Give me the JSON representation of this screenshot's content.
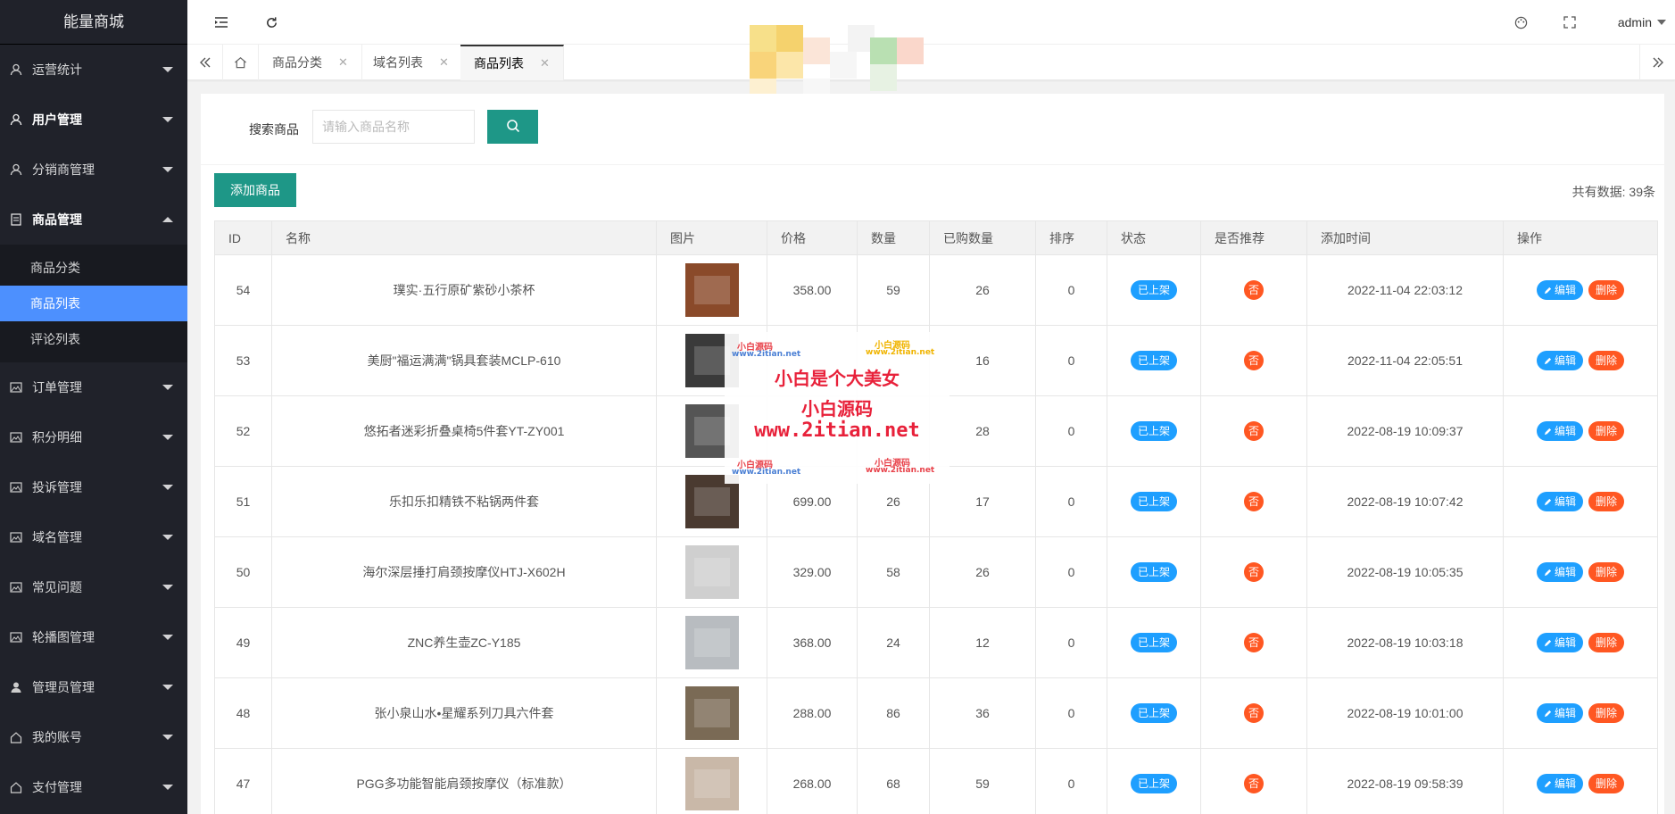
{
  "sidebar": {
    "logo": "能量商城",
    "items": [
      {
        "label": "运营统计"
      },
      {
        "label": "用户管理"
      },
      {
        "label": "分销商管理"
      },
      {
        "label": "商品管理"
      },
      {
        "label": "订单管理"
      },
      {
        "label": "积分明细"
      },
      {
        "label": "投诉管理"
      },
      {
        "label": "域名管理"
      },
      {
        "label": "常见问题"
      },
      {
        "label": "轮播图管理"
      },
      {
        "label": "管理员管理"
      },
      {
        "label": "我的账号"
      },
      {
        "label": "支付管理"
      }
    ],
    "sub_items": [
      {
        "label": "商品分类"
      },
      {
        "label": "商品列表"
      },
      {
        "label": "评论列表"
      }
    ]
  },
  "header": {
    "user": "admin"
  },
  "tabs": [
    {
      "label": "商品分类"
    },
    {
      "label": "域名列表"
    },
    {
      "label": "商品列表"
    }
  ],
  "search": {
    "label": "搜索商品",
    "placeholder": "请输入商品名称"
  },
  "toolbar": {
    "add_label": "添加商品",
    "total": "共有数据:  39条"
  },
  "table": {
    "columns": [
      "ID",
      "名称",
      "图片",
      "价格",
      "数量",
      "已购数量",
      "排序",
      "状态",
      "是否推荐",
      "添加时间",
      "操作"
    ],
    "status_label": "已上架",
    "recommend_label": "否",
    "edit_label": "编辑",
    "delete_label": "删除",
    "rows": [
      {
        "id": "54",
        "name": "璞实·五行原矿紫砂小茶杯",
        "price": "358.00",
        "qty": "59",
        "sold": "26",
        "sort": "0",
        "time": "2022-11-04 22:03:12",
        "color": "#8a4a2a"
      },
      {
        "id": "53",
        "name": "美厨\"福运满满\"锅具套装MCLP-610",
        "price": "",
        "qty": "",
        "sold": "16",
        "sort": "0",
        "time": "2022-11-04 22:05:51",
        "color": "#3a3a3a"
      },
      {
        "id": "52",
        "name": "悠拓者迷彩折叠桌椅5件套YT-ZY001",
        "price": "",
        "qty": "",
        "sold": "28",
        "sort": "0",
        "time": "2022-08-19 10:09:37",
        "color": "#555555"
      },
      {
        "id": "51",
        "name": "乐扣乐扣精铁不粘锅两件套",
        "price": "699.00",
        "qty": "26",
        "sold": "17",
        "sort": "0",
        "time": "2022-08-19 10:07:42",
        "color": "#4a3a30"
      },
      {
        "id": "50",
        "name": "海尔深层捶打肩颈按摩仪HTJ-X602H",
        "price": "329.00",
        "qty": "58",
        "sold": "26",
        "sort": "0",
        "time": "2022-08-19 10:05:35",
        "color": "#cfcfcf"
      },
      {
        "id": "49",
        "name": "ZNC养生壶ZC-Y185",
        "price": "368.00",
        "qty": "24",
        "sold": "12",
        "sort": "0",
        "time": "2022-08-19 10:03:18",
        "color": "#b8bcc0"
      },
      {
        "id": "48",
        "name": "张小泉山水•星耀系列刀具六件套",
        "price": "288.00",
        "qty": "86",
        "sold": "36",
        "sort": "0",
        "time": "2022-08-19 10:01:00",
        "color": "#7a6a55"
      },
      {
        "id": "47",
        "name": "PGG多功能智能肩颈按摩仪（标准款）",
        "price": "268.00",
        "qty": "68",
        "sold": "59",
        "sort": "0",
        "time": "2022-08-19 09:58:39",
        "color": "#c9b8a8"
      }
    ]
  },
  "watermark": {
    "main": "小白是个大美女",
    "sub": "小白源码",
    "url": "www.2itian.net",
    "small_a": "小白源码",
    "small_url_a": "www.2itian.net",
    "small_b": "小白源码",
    "small_url_b": "www.2itian.net"
  },
  "colors": {
    "sidebar_bg": "#20222a",
    "accent": "#1e9787",
    "active_nav": "#4d90fe",
    "blue_badge": "#1e9fff",
    "red_badge": "#ff5722"
  }
}
